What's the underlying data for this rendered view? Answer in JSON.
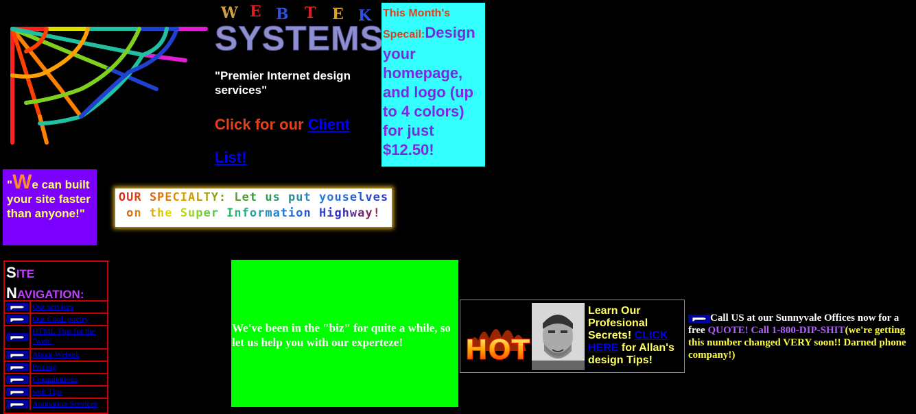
{
  "header": {
    "logo_letters": [
      "W",
      "E",
      "B",
      "T",
      "E",
      "K"
    ],
    "systems": "SYSTEMS",
    "tagline": "\"Premier Internet design services\"",
    "client_prefix": "Click for our ",
    "client_link": "Client List!"
  },
  "special": {
    "heading": "This Month's Specail:",
    "body": "Design your homepage, and logo (up to 4 colors) for just $12.50!"
  },
  "quote": {
    "open": "\"",
    "big_letter": "W",
    "text": "e can built your site faster than anyone!\""
  },
  "specialty_banner": {
    "line1": "OUR SPECIALTY: Let us put youselves",
    "line2": "on the Super Information Highway!"
  },
  "nav": {
    "title_s": "S",
    "title_ite": "ITE",
    "title_n": "N",
    "title_avigation": "AVIGATION:",
    "items": [
      {
        "label": "Our services"
      },
      {
        "label": "Our CooL poetry"
      },
      {
        "label": "HTML Tips for the \"web\""
      },
      {
        "label": "About Webtek"
      },
      {
        "label": "Pricing"
      },
      {
        "label": "Consultations"
      },
      {
        "label": "web Tips"
      },
      {
        "label": "Animation Services"
      }
    ]
  },
  "green_box": {
    "text": "We've been in the \"biz\" for quite a while, so let us help you with our experteze!"
  },
  "hot_section": {
    "hot_word": "HOT",
    "learn_prefix": "Learn Our Profesional Secrets! ",
    "learn_link": "CLICK HERE",
    "learn_suffix": " for Allan's design Tips!"
  },
  "call": {
    "text1": "Call US at our Sunnyvale Offices now for a free ",
    "quote_word": "QUOTE! Call 1-800-DIP-SHIT",
    "text2": "(we're getting this number changed VERY soon!! Darned phone company!)"
  },
  "colors": {
    "background": "#000000",
    "special_bg": "#33ffff",
    "quote_bg": "#7b00ff",
    "green_bg": "#00ff00",
    "nav_border": "#cc0000",
    "link": "#0000ee"
  }
}
